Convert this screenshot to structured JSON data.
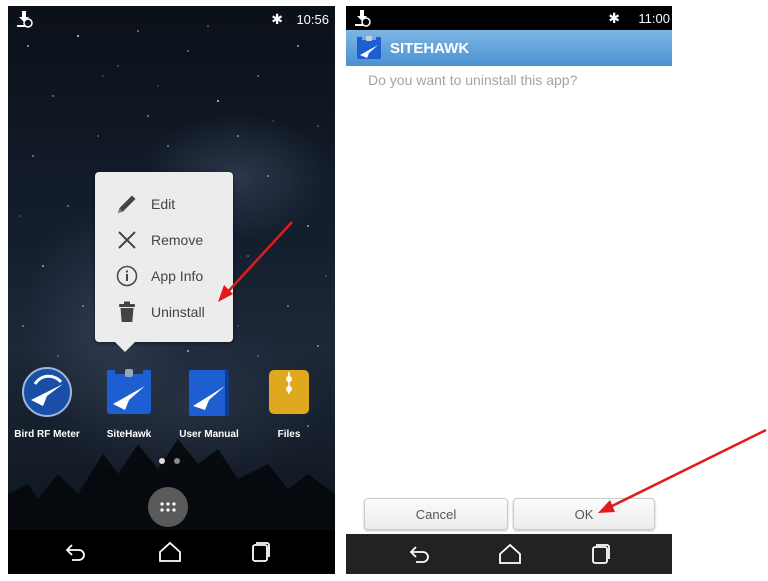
{
  "left_screen": {
    "status": {
      "bluetooth": "✱",
      "time": "10:56"
    },
    "popup_menu": {
      "items": [
        {
          "label": "Edit",
          "icon": "pencil-icon"
        },
        {
          "label": "Remove",
          "icon": "close-icon"
        },
        {
          "label": "App Info",
          "icon": "info-icon"
        },
        {
          "label": "Uninstall",
          "icon": "trash-icon"
        }
      ]
    },
    "apps": [
      {
        "label": "Bird RF Meter",
        "icon": "bird-rf-meter-icon"
      },
      {
        "label": "SiteHawk",
        "icon": "sitehawk-icon"
      },
      {
        "label": "User Manual",
        "icon": "user-manual-icon"
      },
      {
        "label": "Files",
        "icon": "files-icon"
      }
    ]
  },
  "right_screen": {
    "status": {
      "bluetooth": "✱",
      "time": "11:00"
    },
    "title": "SITEHAWK",
    "question": "Do you want to uninstall this app?",
    "buttons": {
      "cancel": "Cancel",
      "ok": "OK"
    }
  },
  "colors": {
    "titlebar": "#4a92d2",
    "annotation_arrow": "#e01b1b",
    "app_blue": "#1d5fd1"
  }
}
